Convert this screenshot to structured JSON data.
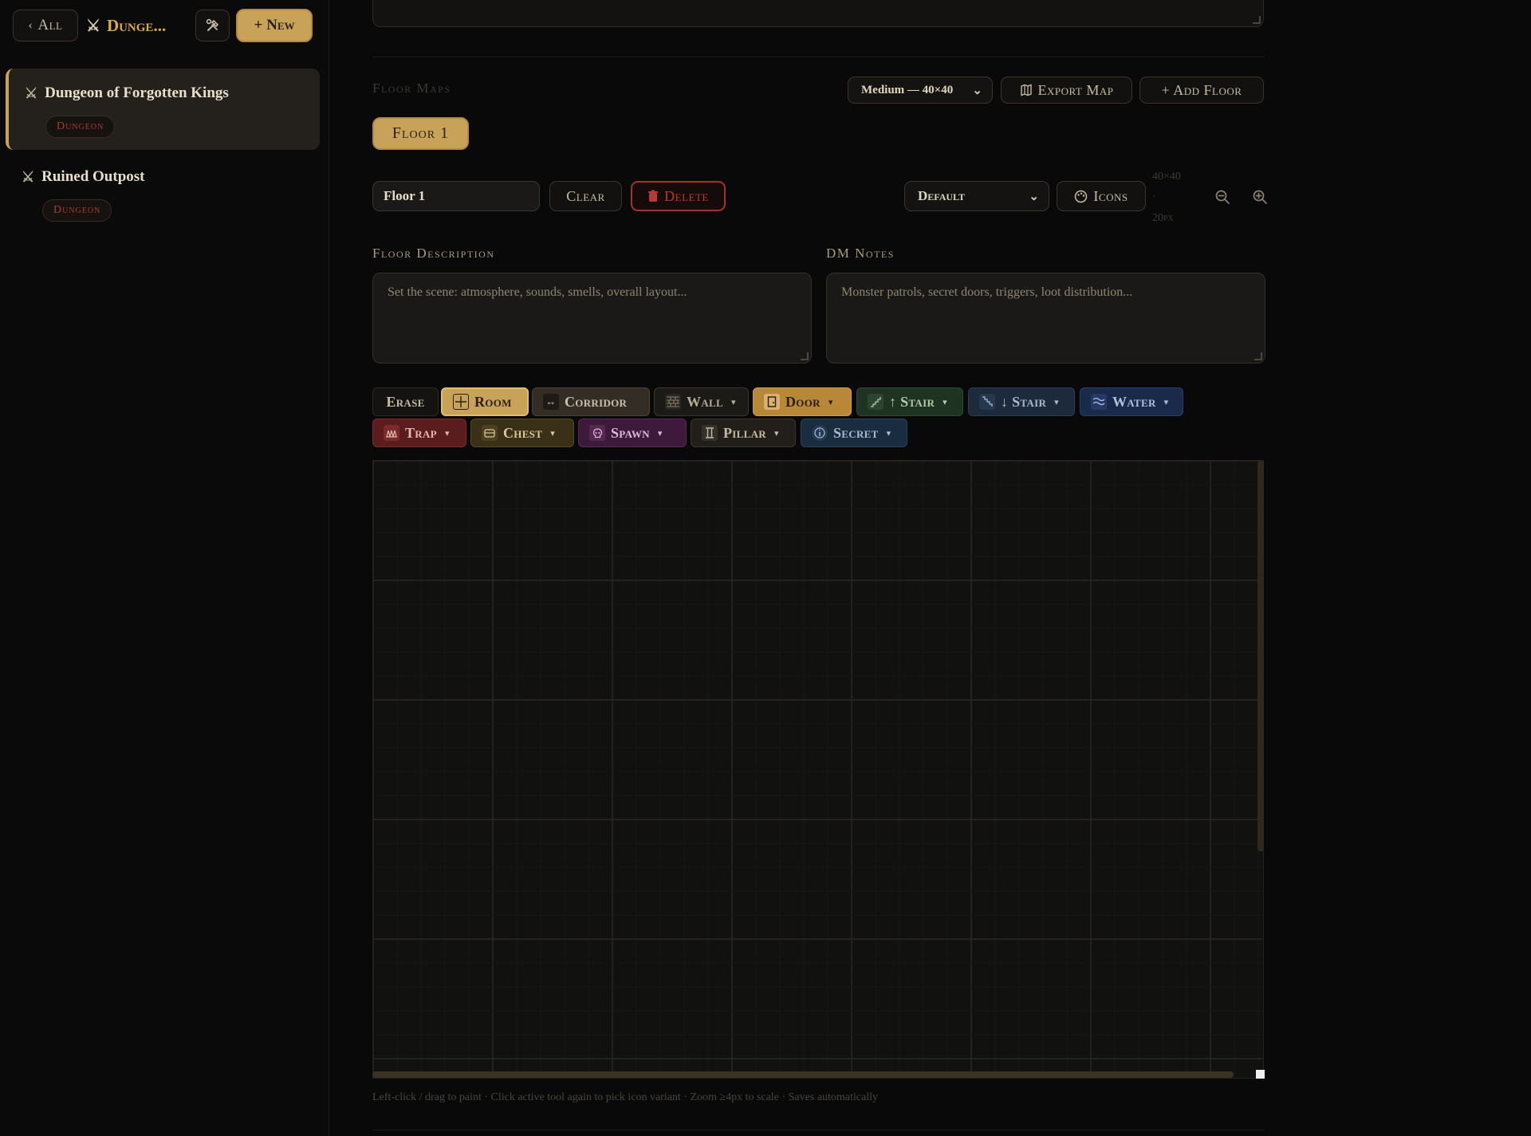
{
  "sidebar": {
    "back_label": "All",
    "project_title": "Dunge...",
    "new_label": "+ New",
    "projects": [
      {
        "name": "Dungeon of Forgotten Kings",
        "type": "Dungeon",
        "active": true
      },
      {
        "name": "Ruined Outpost",
        "type": "Dungeon",
        "active": false
      }
    ]
  },
  "floor_maps": {
    "section_label": "Floor Maps",
    "size_select": "Medium — 40×40",
    "export_label": "Export Map",
    "add_floor_label": "+ Add Floor",
    "tabs": [
      {
        "label": "Floor 1",
        "active": true
      }
    ]
  },
  "floor_controls": {
    "name_value": "Floor 1",
    "clear_label": "Clear",
    "delete_label": "Delete",
    "style_select": "Default",
    "icons_label": "Icons",
    "grid_size": "40×40",
    "separator": "·",
    "cell_size": "20px"
  },
  "descriptions": {
    "floor_label": "Floor Description",
    "floor_placeholder": "Set the scene: atmosphere, sounds, smells, overall layout...",
    "dm_label": "DM Notes",
    "dm_placeholder": "Monster patrols, secret doors, triggers, loot distribution..."
  },
  "tools": {
    "erase": "Erase",
    "room": "Room",
    "corridor": "Corridor",
    "wall": "Wall",
    "door": "Door",
    "stair_up": "↑ Stair",
    "stair_down": "↓ Stair",
    "water": "Water",
    "trap": "Trap",
    "chest": "Chest",
    "spawn": "Spawn",
    "pillar": "Pillar",
    "secret": "Secret"
  },
  "hint": "Left-click / drag to paint · Click active tool again to pick icon variant · Zoom ≥4px to scale · Saves automatically",
  "colors": {
    "accent_gold": "#c9a25a",
    "danger_red": "#a82f2b",
    "background": "#090909"
  }
}
